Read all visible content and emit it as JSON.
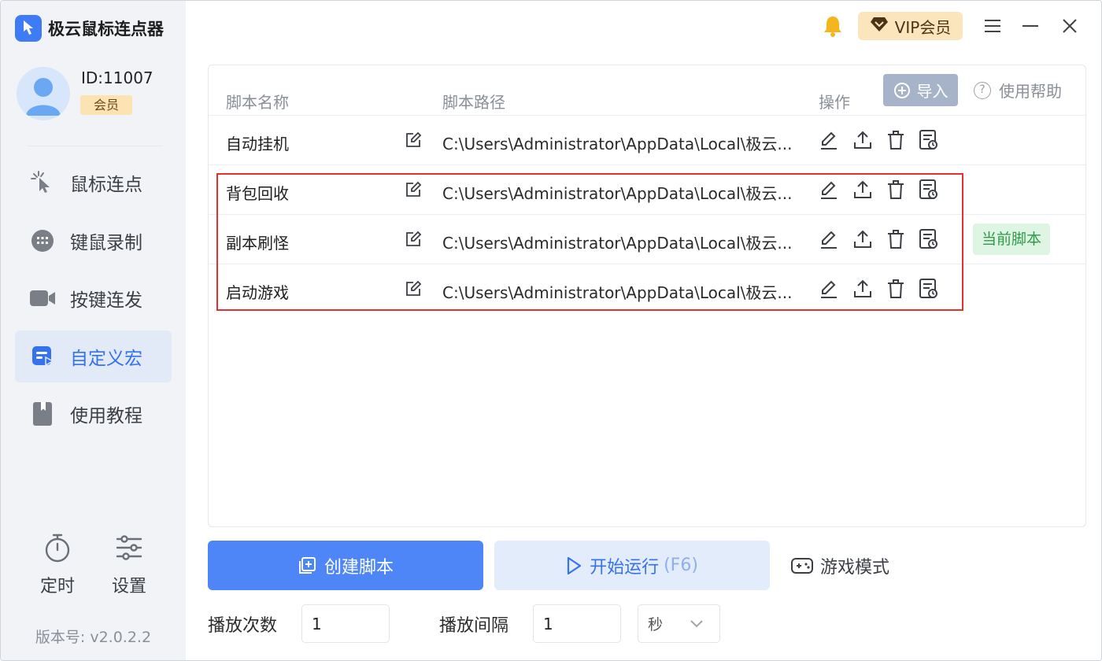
{
  "app": {
    "title": "极云鼠标连点器"
  },
  "titlebar": {
    "vip_label": "VIP会员"
  },
  "user": {
    "id": "ID:11007",
    "badge": "会员"
  },
  "nav": {
    "items": [
      {
        "label": "鼠标连点",
        "icon": "cursor-click-icon"
      },
      {
        "label": "键鼠录制",
        "icon": "keyboard-mouse-icon"
      },
      {
        "label": "按键连发",
        "icon": "video-camera-icon"
      },
      {
        "label": "自定义宏",
        "icon": "macro-icon",
        "active": true
      },
      {
        "label": "使用教程",
        "icon": "book-icon"
      }
    ],
    "timer_label": "定时",
    "settings_label": "设置",
    "version": "版本号: v2.0.2.2"
  },
  "table": {
    "headers": {
      "name": "脚本名称",
      "path": "脚本路径",
      "actions": "操作"
    },
    "import_label": "导入",
    "help_label": "使用帮助",
    "rows": [
      {
        "name": "自动挂机",
        "path": "C:\\Users\\Administrator\\AppData\\Local\\极云..."
      },
      {
        "name": "背包回收",
        "path": "C:\\Users\\Administrator\\AppData\\Local\\极云..."
      },
      {
        "name": "副本刷怪",
        "path": "C:\\Users\\Administrator\\AppData\\Local\\极云...",
        "tag": "当前脚本"
      },
      {
        "name": "启动游戏",
        "path": "C:\\Users\\Administrator\\AppData\\Local\\极云..."
      }
    ]
  },
  "controls": {
    "create_label": "创建脚本",
    "run_label": "开始运行",
    "run_hotkey": "(F6)",
    "game_mode_label": "游戏模式",
    "play_count_label": "播放次数",
    "play_count_value": "1",
    "play_interval_label": "播放间隔",
    "play_interval_value": "1",
    "unit_value": "秒"
  },
  "colors": {
    "accent": "#4f86f7",
    "highlight": "#e5312e",
    "current_tag": "#2f9a49"
  }
}
